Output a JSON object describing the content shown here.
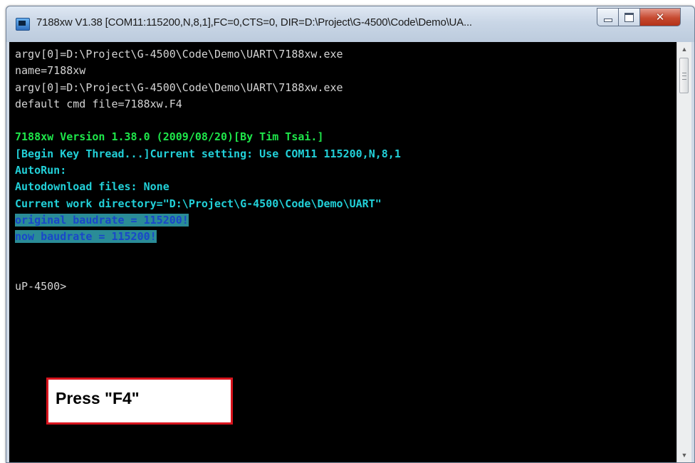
{
  "window": {
    "title": "7188xw V1.38 [COM11:115200,N,8,1],FC=0,CTS=0, DIR=D:\\Project\\G-4500\\Code\\Demo\\UA...",
    "icon": "console-app-icon",
    "buttons": {
      "minimize": "minimize-icon",
      "maximize": "maximize-icon",
      "close_symbol": "✕"
    }
  },
  "terminal": {
    "lines": [
      {
        "color": "white",
        "text": "argv[0]=D:\\Project\\G-4500\\Code\\Demo\\UART\\7188xw.exe"
      },
      {
        "color": "white",
        "text": "name=7188xw"
      },
      {
        "color": "white",
        "text": "argv[0]=D:\\Project\\G-4500\\Code\\Demo\\UART\\7188xw.exe"
      },
      {
        "color": "white",
        "text": "default cmd file=7188xw.F4"
      },
      {
        "color": "white",
        "text": ""
      },
      {
        "color": "green",
        "text": "7188xw Version 1.38.0 (2009/08/20)[By Tim Tsai.]"
      },
      {
        "color": "cyan",
        "text": "[Begin Key Thread...]Current setting: Use COM11 115200,N,8,1"
      },
      {
        "color": "cyan",
        "text": "AutoRun:"
      },
      {
        "color": "cyan",
        "text": "Autodownload files: None"
      },
      {
        "color": "cyan",
        "text": "Current work directory=\"D:\\Project\\G-4500\\Code\\Demo\\UART\""
      },
      {
        "color": "selected",
        "text": "original baudrate = 115200!"
      },
      {
        "color": "selected",
        "text": "now baudrate = 115200!"
      },
      {
        "color": "white",
        "text": ""
      },
      {
        "color": "white",
        "text": ""
      },
      {
        "color": "white",
        "text": "uP-4500>"
      }
    ]
  },
  "annotation": {
    "text": "Press \"F4\""
  },
  "colors": {
    "console_bg": "#000000",
    "text_white": "#d4d4d4",
    "text_green": "#1ee64a",
    "text_cyan": "#22d0d8",
    "selection_bg": "#2a8c97",
    "selection_text": "#1a47c9",
    "annotation_border": "#d8141d"
  }
}
